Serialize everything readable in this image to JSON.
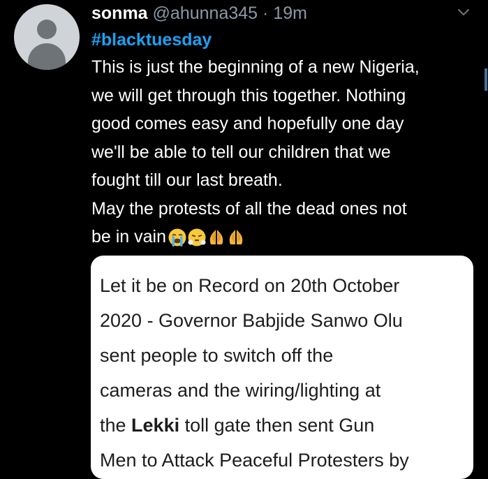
{
  "tweet": {
    "display_name": "sonma",
    "handle": "@ahunna345",
    "separator": "·",
    "time": "19m",
    "hashtag": "#blacktuesday",
    "lines": [
      "This is just the beginning of a new Nigeria,",
      "we will get through this together.  Nothing",
      "good comes easy and hopefully one day",
      "we'll be able to tell our children that we",
      "fought till our last breath.",
      "May the protests of all the dead ones not",
      "be in vain"
    ],
    "emojis": [
      "loudly-crying-face",
      "face-with-steam",
      "folded-hands",
      "folded-hands"
    ]
  },
  "attachment": {
    "lines": [
      "Let it be on Record on 20th October",
      "2020 - Governor Babjide Sanwo Olu",
      "sent people to  switch off the",
      "cameras and the wiring/lighting at"
    ],
    "line5_before": "the ",
    "line5_bold": "Lekki",
    "line5_after": " toll gate then sent Gun",
    "line6": "Men to Attack Peaceful Protesters by"
  },
  "colors": {
    "background": "#000000",
    "text": "#ffffff",
    "muted": "#8b98a5",
    "link": "#1da1f2"
  },
  "icons": [
    "default-avatar-icon",
    "chevron-down-icon"
  ]
}
